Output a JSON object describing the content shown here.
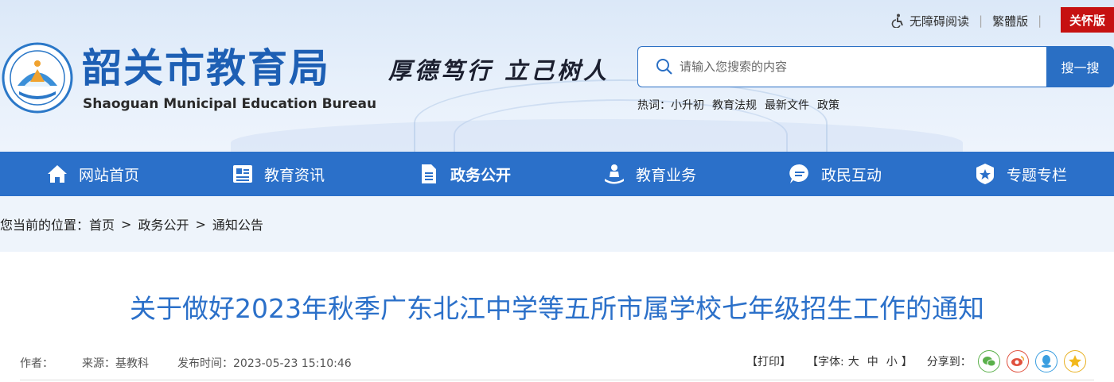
{
  "header": {
    "title": "韶关市教育局",
    "subtitle": "Shaoguan Municipal Education Bureau",
    "motto": "厚德笃行 立己树人",
    "top_links": {
      "accessibility": "无障碍阅读",
      "traditional": "繁體版",
      "care": "关怀版"
    },
    "search": {
      "placeholder": "请输入您搜索的内容",
      "button": "搜一搜"
    },
    "hotwords": {
      "label": "热词：",
      "items": [
        "小升初",
        "教育法规",
        "最新文件",
        "政策"
      ]
    }
  },
  "nav": {
    "items": [
      {
        "label": "网站首页",
        "icon": "home-icon"
      },
      {
        "label": "教育资讯",
        "icon": "news-icon"
      },
      {
        "label": "政务公开",
        "icon": "document-icon"
      },
      {
        "label": "教育业务",
        "icon": "education-icon"
      },
      {
        "label": "政民互动",
        "icon": "chat-icon"
      },
      {
        "label": "专题专栏",
        "icon": "badge-icon"
      }
    ],
    "active": "政务公开"
  },
  "breadcrumb": {
    "prefix": "您当前的位置：",
    "items": [
      "首页",
      "政务公开",
      "通知公告"
    ],
    "separator": ">"
  },
  "article": {
    "title": "关于做好2023年秋季广东北江中学等五所市属学校七年级招生工作的通知",
    "meta": {
      "author": "作者：",
      "source": "来源：基教科",
      "published": "发布时间：2023-05-23 15:10:46"
    },
    "tools": {
      "print": "【打印】",
      "font_label": "【字体:",
      "font_large": "大",
      "font_medium": "中",
      "font_small": "小",
      "font_close": "】",
      "share_label": "分享到："
    },
    "share_icons": [
      "wechat-icon",
      "weibo-icon",
      "qq-icon",
      "qzone-icon"
    ]
  },
  "colors": {
    "primary": "#2b70c9",
    "title_blue": "#1d5fb4",
    "care_red": "#c61111"
  }
}
